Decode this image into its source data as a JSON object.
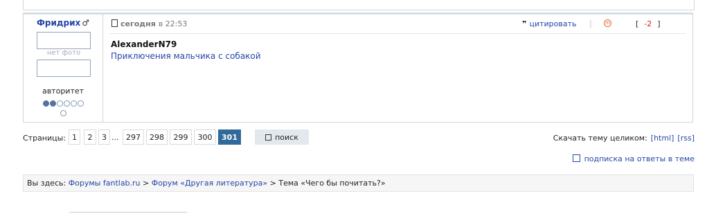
{
  "post": {
    "author": "Фридрих",
    "gender_symbol": "♂",
    "no_photo": "нет фото",
    "rank": "авторитет",
    "date_day": "сегодня",
    "date_time": "в 22:53",
    "quote_label": "цитировать",
    "quote_icon": "quote-marks",
    "moderator_icon": "m",
    "score": "-2",
    "score_open": "[",
    "score_close": "]",
    "reply_to": "AlexanderN79",
    "text": "Приключения мальчика с собакой",
    "rating": {
      "filled": 2,
      "total": 7
    }
  },
  "pager": {
    "label": "Страницы:",
    "pages": [
      "1",
      "2",
      "3",
      "297",
      "298",
      "299",
      "300",
      "301"
    ],
    "ellipsis": "...",
    "current": "301",
    "search_label": "поиск"
  },
  "download": {
    "label": "Скачать тему целиком:",
    "html": "[html]",
    "rss": "[rss]"
  },
  "subscribe": {
    "label": "подписка на ответы в теме"
  },
  "breadcrumb": {
    "prefix": "Вы здесь:",
    "item1": "Форумы fantlab.ru",
    "sep": ">",
    "item2": "Форум «Другая литература»",
    "item3": "Тема «Чего бы почитать?»"
  }
}
